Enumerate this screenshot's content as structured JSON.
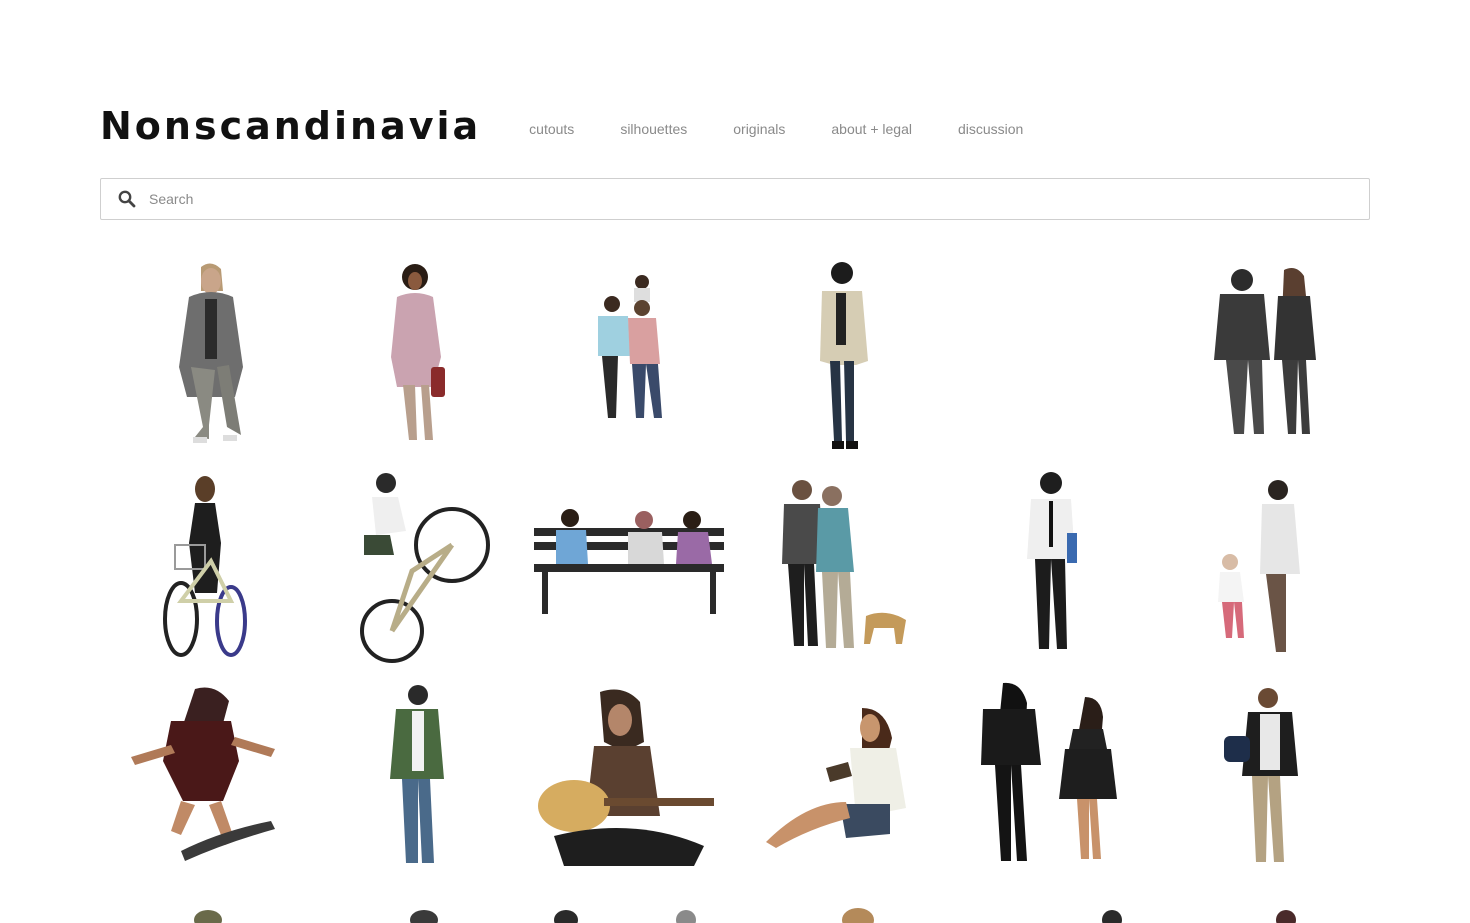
{
  "site": {
    "title": "Nonscandinavia"
  },
  "nav": {
    "items": [
      "cutouts",
      "silhouettes",
      "originals",
      "about + legal",
      "discussion"
    ]
  },
  "search": {
    "placeholder": "Search",
    "value": "",
    "icon": "search-icon"
  },
  "grid": {
    "columns": 6,
    "items": [
      {
        "name": "long-haired-man-grey-coat"
      },
      {
        "name": "woman-pink-coat-bag"
      },
      {
        "name": "couple-with-child-on-shoulders"
      },
      {
        "name": "man-beige-jacket"
      },
      {
        "name": "empty-cell"
      },
      {
        "name": "couple-walking-from-behind"
      },
      {
        "name": "woman-on-bicycle-basket"
      },
      {
        "name": "man-bike-wheelie"
      },
      {
        "name": "three-people-on-bench"
      },
      {
        "name": "two-men-walking-dog"
      },
      {
        "name": "man-white-shirt-tie"
      },
      {
        "name": "man-with-toddler"
      },
      {
        "name": "skateboarder-jumping"
      },
      {
        "name": "man-camo-jacket"
      },
      {
        "name": "woman-playing-guitar"
      },
      {
        "name": "woman-sitting-reading"
      },
      {
        "name": "two-women-black-outfits"
      },
      {
        "name": "man-carrying-duffel-bag"
      }
    ]
  },
  "colors": {
    "logo": "#111111",
    "nav_text": "#8a8a8a",
    "search_border": "#cfcfcf",
    "search_icon": "#444444"
  }
}
